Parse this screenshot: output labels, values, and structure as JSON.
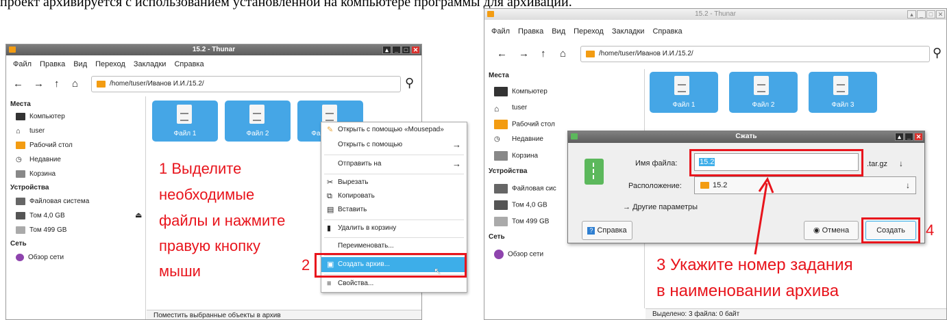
{
  "top_text": "проект архивируется с использованием установленной на компьютере программы для архивации.",
  "colors": {
    "accent": "#45a6e6",
    "annotation_red": "#e8141c",
    "folder": "#f39c12"
  },
  "left_window": {
    "title": "15.2 - Thunar",
    "menu": [
      "Файл",
      "Правка",
      "Вид",
      "Переход",
      "Закладки",
      "Справка"
    ],
    "path": "/home/tuser/Иванов И.И./15.2/",
    "sidebar": {
      "places_heading": "Места",
      "places": [
        "Компьютер",
        "tuser",
        "Рабочий стол",
        "Недавние",
        "Корзина"
      ],
      "devices_heading": "Устройства",
      "devices": [
        "Файловая система",
        "Том 4,0 GB",
        "Том 499 GB"
      ],
      "network_heading": "Сеть",
      "network": [
        "Обзор сети"
      ]
    },
    "files": [
      "Файл 1",
      "Файл 2",
      "Фа"
    ],
    "status": "Поместить выбранные объекты в архив"
  },
  "context_menu": {
    "items": [
      "Открыть с помощью «Mousepad»",
      "Открыть с помощью",
      "Отправить на",
      "Вырезать",
      "Копировать",
      "Вставить",
      "Удалить в корзину",
      "Переименовать...",
      "Создать архив...",
      "Свойства..."
    ]
  },
  "annotations": {
    "step1_lines": [
      "1 Выделите",
      "необходимые",
      "файлы и нажмите",
      "правую кнопку",
      "мыши"
    ],
    "step2": "2",
    "step3_lines": [
      "3 Укажите номер задания",
      "в наименовании архива"
    ],
    "step4": "4"
  },
  "right_window": {
    "title": "15.2 - Thunar",
    "menu": [
      "Файл",
      "Правка",
      "Вид",
      "Переход",
      "Закладки",
      "Справка"
    ],
    "path": "/home/tuser/Иванов И.И./15.2/",
    "sidebar": {
      "places_heading": "Места",
      "places": [
        "Компьютер",
        "tuser",
        "Рабочий стол",
        "Недавние",
        "Корзина"
      ],
      "devices_heading": "Устройства",
      "devices": [
        "Файловая сис",
        "Том 4,0 GB",
        "Том 499 GB"
      ],
      "network_heading": "Сеть",
      "network": [
        "Обзор сети"
      ]
    },
    "files": [
      "Файл 1",
      "Файл 2",
      "Файл 3"
    ],
    "status": "Выделено: 3 файла: 0 байт"
  },
  "dialog": {
    "title": "Сжать",
    "filename_label": "Имя файла:",
    "filename_value": "15.2",
    "extension": ".tar.gz",
    "location_label": "Расположение:",
    "location_value": "15.2",
    "more_options": "Другие параметры",
    "help_button": "Справка",
    "cancel_button": "Отмена",
    "create_button": "Создать"
  }
}
